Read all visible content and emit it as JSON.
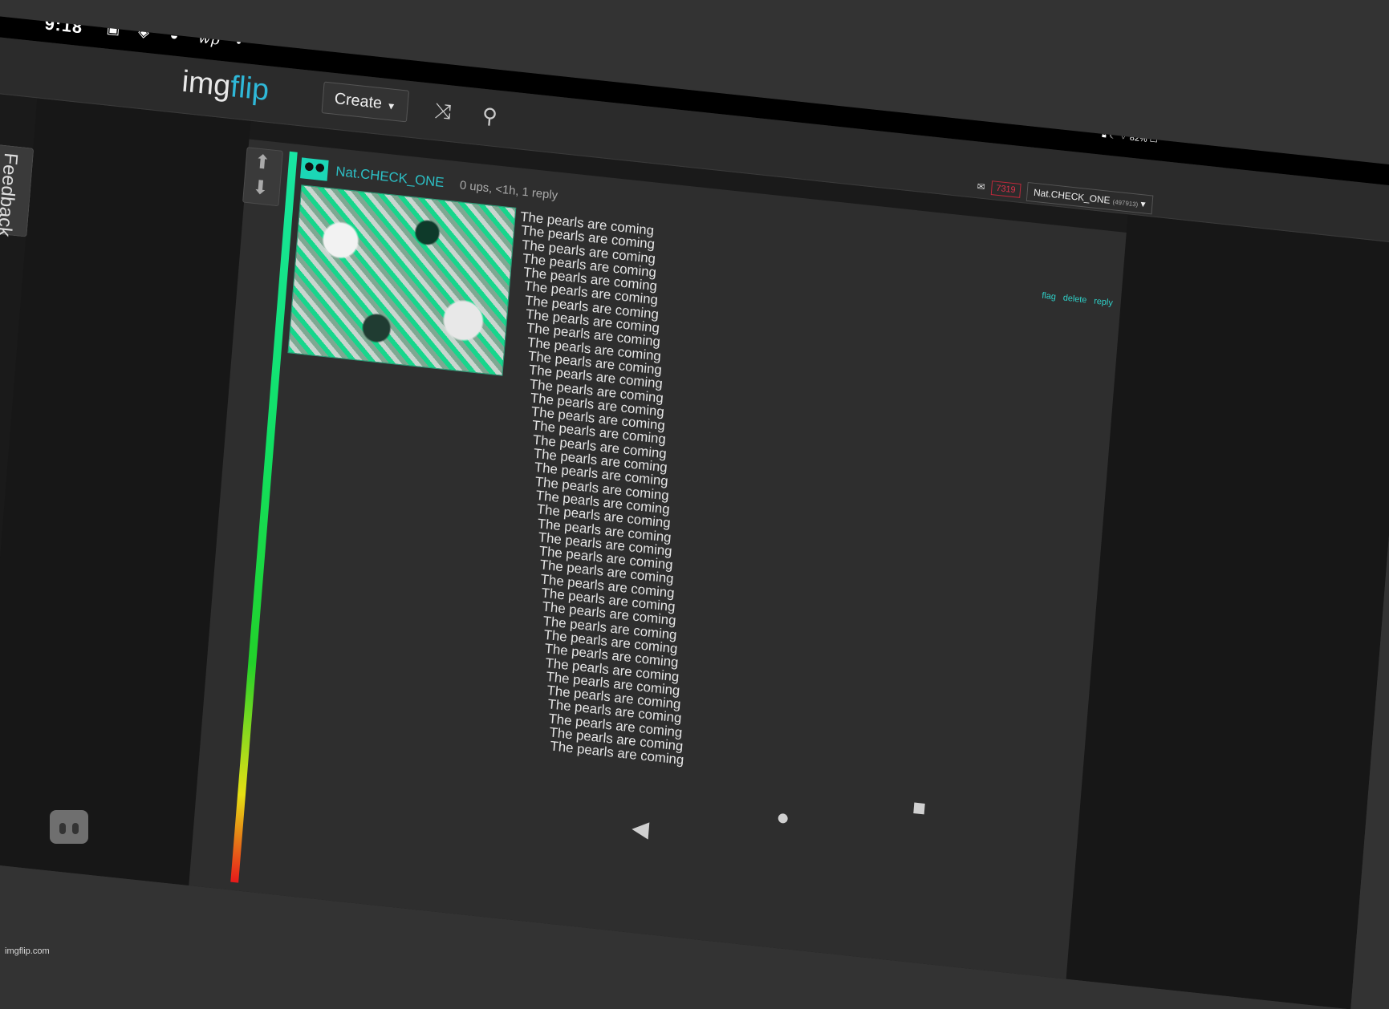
{
  "status_bar": {
    "time": "9:18",
    "icons": [
      "image-icon",
      "cast-icon",
      "bag-icon",
      "wp-icon",
      "dot-icon"
    ],
    "wp_label": "wp",
    "battery": "82%"
  },
  "header": {
    "logo_main": "img",
    "logo_accent": "flip",
    "create_label": "Create",
    "notifications": "7319",
    "username": "Nat.CHECK_ONE",
    "user_points": "(497913)"
  },
  "sidebar": {
    "feedback_label": "Feedback"
  },
  "comment": {
    "username": "Nat.CHECK_ONE",
    "meta": "0 ups, <1h, 1 reply",
    "actions": [
      "flag",
      "delete",
      "reply"
    ],
    "lines": [
      "The pearls are coming",
      "The pearls are coming",
      "The pearls are coming",
      "The pearls are coming",
      "The pearls are coming",
      "The pearls are coming",
      "The pearls are coming",
      "The pearls are coming",
      "The pearls are coming",
      "The pearls are coming",
      "The pearls are coming",
      "The pearls are coming",
      "The pearls are coming",
      "The pearls are coming",
      "The pearls are coming",
      "The pearls are coming",
      "The pearls are coming",
      "The pearls are coming",
      "The pearls are coming",
      "The pearls are coming",
      "The pearls are coming",
      "The pearls are coming",
      "The pearls are coming",
      "The pearls are coming",
      "The pearls are coming",
      "The pearls are coming",
      "The pearls are coming",
      "The pearls are coming",
      "The pearls are coming",
      "The pearls are coming",
      "The pearls are coming",
      "The pearls are coming",
      "The pearls are coming",
      "The pearls are coming",
      "The pearls are coming",
      "The pearls are coming",
      "The pearls are coming",
      "The pearls are coming",
      "The pearls are coming"
    ]
  },
  "footer": {
    "watermark": "imgflip.com"
  },
  "colors": {
    "accent": "#2fb8d8",
    "username": "#2cc0c6",
    "background": "#333333"
  }
}
